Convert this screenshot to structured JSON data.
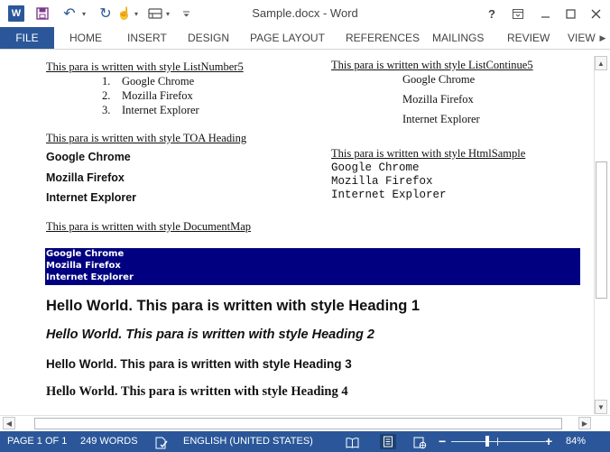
{
  "app": {
    "app_icon_letter": "W",
    "title": "Sample.docx - Word",
    "help_label": "?"
  },
  "ribbon": {
    "tabs": [
      "FILE",
      "HOME",
      "INSERT",
      "DESIGN",
      "PAGE LAYOUT",
      "REFERENCES",
      "MAILINGS",
      "REVIEW",
      "VIEW"
    ]
  },
  "document": {
    "list_number5": {
      "caption": "This para is written with style ListNumber5",
      "items": [
        {
          "num": "1.",
          "text": "Google Chrome"
        },
        {
          "num": "2.",
          "text": "Mozilla Firefox"
        },
        {
          "num": "3.",
          "text": "Internet Explorer"
        }
      ]
    },
    "list_continue5": {
      "caption": "This para is written with style ListContinue5",
      "items": [
        "Google Chrome",
        "Mozilla Firefox",
        "Internet Explorer"
      ]
    },
    "toa_heading": {
      "caption": "This para is written with style TOA Heading",
      "items": [
        "Google Chrome",
        "Mozilla Firefox",
        "Internet Explorer"
      ]
    },
    "html_sample": {
      "caption": "This para is written with style HtmlSample",
      "items": [
        "Google Chrome",
        "Mozilla Firefox",
        "Internet Explorer"
      ]
    },
    "document_map": {
      "caption": "This para is written with style DocumentMap",
      "items": [
        "Google Chrome",
        "Mozilla Firefox",
        "Internet Explorer"
      ]
    },
    "headings": [
      "Hello World. This para is written with style Heading 1",
      "Hello World. This para is written with style Heading 2",
      "Hello World. This para is written with style Heading 3",
      "Hello World. This para is written with style Heading 4"
    ]
  },
  "statusbar": {
    "page": "PAGE 1 OF 1",
    "words": "249 WORDS",
    "language": "ENGLISH (UNITED STATES)",
    "zoom_out": "−",
    "zoom_in": "+",
    "zoom_level": "84%"
  },
  "icons": {
    "save": "save-icon",
    "undo": "undo-icon",
    "redo": "redo-icon",
    "touch_mode": "touch-mode-icon",
    "table": "table-icon",
    "customize": "customize-qat-icon",
    "ribbon_display": "ribbon-display-icon",
    "minimize": "minimize-icon",
    "maximize": "maximize-icon",
    "close": "close-icon",
    "proofing": "proofing-icon",
    "read_mode": "read-mode-icon",
    "print_layout": "print-layout-icon",
    "web_layout": "web-layout-icon"
  },
  "colors": {
    "accent": "#2b579a",
    "document_map_background": "#000080"
  }
}
